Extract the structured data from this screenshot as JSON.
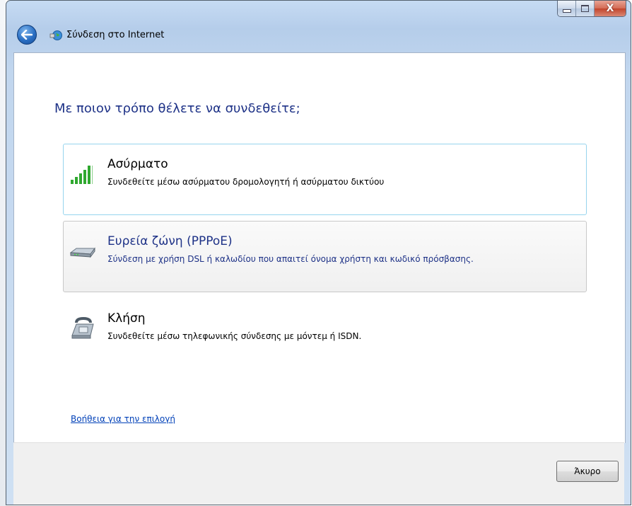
{
  "window": {
    "title": "Σύνδεση στο Internet",
    "close_glyph": "X"
  },
  "heading": "Με ποιον τρόπο θέλετε να συνδεθείτε;",
  "options": [
    {
      "icon": "wireless-signal-icon",
      "title": "Ασύρματο",
      "description": "Συνδεθείτε μέσω ασύρματου δρομολογητή ή ασύρματου δικτύου"
    },
    {
      "icon": "broadband-modem-icon",
      "title": "Ευρεία ζώνη (PPPoE)",
      "description": "Σύνδεση με χρήση DSL ή καλωδίου που απαιτεί όνομα χρήστη και κωδικό πρόσβασης."
    },
    {
      "icon": "dialup-phone-icon",
      "title": "Κλήση",
      "description": "Συνδεθείτε μέσω τηλεφωνικής σύνδεσης με μόντεμ ή ISDN."
    }
  ],
  "help_link": "Βοήθεια για την επιλογή",
  "buttons": {
    "cancel": "Άκυρο"
  },
  "colors": {
    "heading": "#1e3287",
    "link": "#0040b8",
    "focus_border": "#96d4ee"
  }
}
